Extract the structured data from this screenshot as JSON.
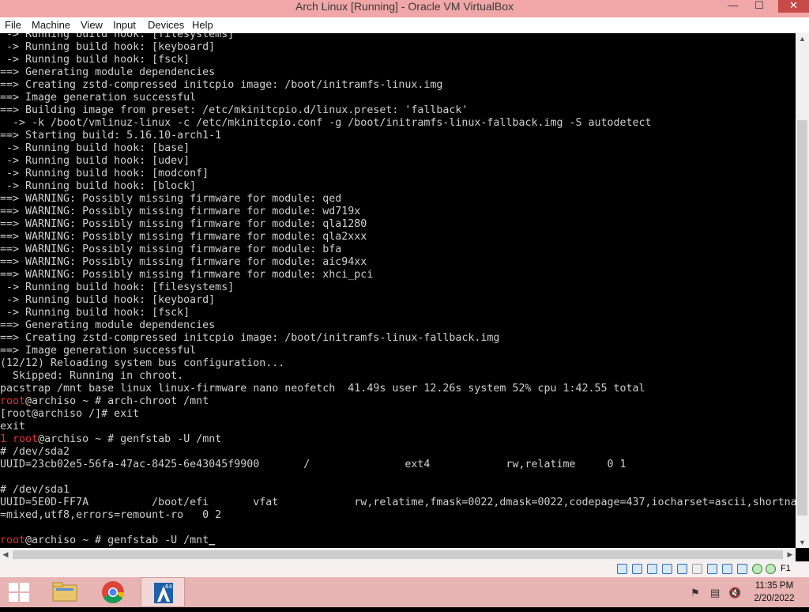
{
  "window": {
    "title": "Arch Linux [Running] - Oracle VM VirtualBox",
    "min_glyph": "—",
    "max_glyph": "☐",
    "close_glyph": "✕"
  },
  "menu": [
    "File",
    "Machine",
    "View",
    "Input",
    "Devices",
    "Help"
  ],
  "terminal": {
    "lines": [
      " -> Running build hook: [filesystems]",
      " -> Running build hook: [keyboard]",
      " -> Running build hook: [fsck]",
      "==> Generating module dependencies",
      "==> Creating zstd-compressed initcpio image: /boot/initramfs-linux.img",
      "==> Image generation successful",
      "==> Building image from preset: /etc/mkinitcpio.d/linux.preset: 'fallback'",
      "  -> -k /boot/vmlinuz-linux -c /etc/mkinitcpio.conf -g /boot/initramfs-linux-fallback.img -S autodetect",
      "==> Starting build: 5.16.10-arch1-1",
      " -> Running build hook: [base]",
      " -> Running build hook: [udev]",
      " -> Running build hook: [modconf]",
      " -> Running build hook: [block]",
      "==> WARNING: Possibly missing firmware for module: qed",
      "==> WARNING: Possibly missing firmware for module: wd719x",
      "==> WARNING: Possibly missing firmware for module: qla1280",
      "==> WARNING: Possibly missing firmware for module: qla2xxx",
      "==> WARNING: Possibly missing firmware for module: bfa",
      "==> WARNING: Possibly missing firmware for module: aic94xx",
      "==> WARNING: Possibly missing firmware for module: xhci_pci",
      " -> Running build hook: [filesystems]",
      " -> Running build hook: [keyboard]",
      " -> Running build hook: [fsck]",
      "==> Generating module dependencies",
      "==> Creating zstd-compressed initcpio image: /boot/initramfs-linux-fallback.img",
      "==> Image generation successful",
      "(12/12) Reloading system bus configuration...",
      "  Skipped: Running in chroot.",
      "pacstrap /mnt base linux linux-firmware nano neofetch  41.49s user 12.26s system 52% cpu 1:42.55 total"
    ],
    "prompt_user": "root",
    "prompt_host": "@archiso",
    "prompt_tail": " ~ # ",
    "cmd_chroot": "arch-chroot /mnt",
    "chroot_prompt": "[root@archiso /]# ",
    "cmd_exit": "exit",
    "exit_output": "exit",
    "status_code": "1",
    "cmd_genfstab": "genfstab -U /mnt",
    "fstab": [
      "# /dev/sda2",
      "UUID=23cb02e5-56fa-47ac-8425-6e43045f9900       /               ext4            rw,relatime     0 1",
      "",
      "# /dev/sda1",
      "UUID=5E0D-FF7A          /boot/efi       vfat            rw,relatime,fmask=0022,dmask=0022,codepage=437,iocharset=ascii,shortna",
      "=mixed,utf8,errors=remount-ro   0 2",
      ""
    ],
    "current_cmd": "genfstab -U /mnt",
    "cursor": "_"
  },
  "statusbar": {
    "host_key": "F1",
    "icons": [
      "hard-disk-icon",
      "optical-drive-icon",
      "audio-icon",
      "network-icon",
      "usb-icon",
      "shared-folders-icon",
      "display-icon",
      "recording-icon",
      "cpu-virtualization-icon",
      "mouse-integration-icon",
      "keyboard-icon"
    ]
  },
  "taskbar": {
    "time": "11:35 PM",
    "date": "2/20/2022",
    "apps": [
      "file-explorer",
      "chrome",
      "virtualbox"
    ],
    "vbox_badge": "64"
  }
}
